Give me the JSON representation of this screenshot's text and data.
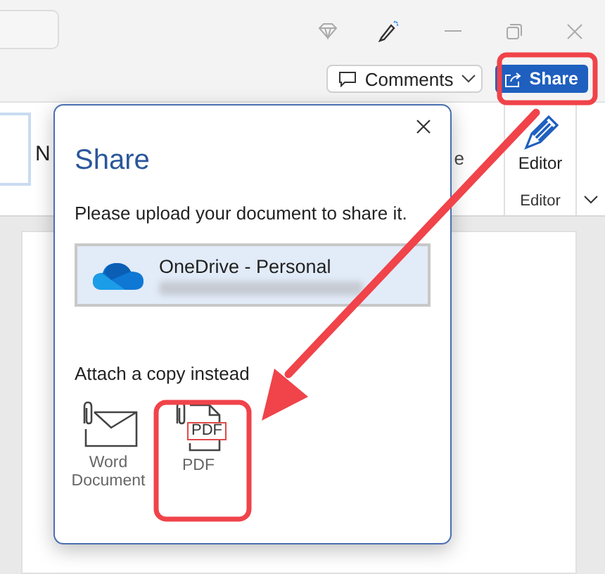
{
  "command_bar": {
    "comments_label": "Comments",
    "share_label": "Share"
  },
  "ribbon": {
    "left_fragment": "N",
    "right_fragment": "e",
    "editor_button": "Editor",
    "group_label": "Editor"
  },
  "dialog": {
    "title": "Share",
    "message": "Please upload your document to share it.",
    "locations": [
      {
        "name": "OneDrive - Personal",
        "selected": true
      }
    ],
    "attach_heading": "Attach a copy instead",
    "attach_options": [
      {
        "kind": "word",
        "label": "Word Document"
      },
      {
        "kind": "pdf",
        "label": "PDF",
        "badge": "PDF"
      }
    ]
  }
}
